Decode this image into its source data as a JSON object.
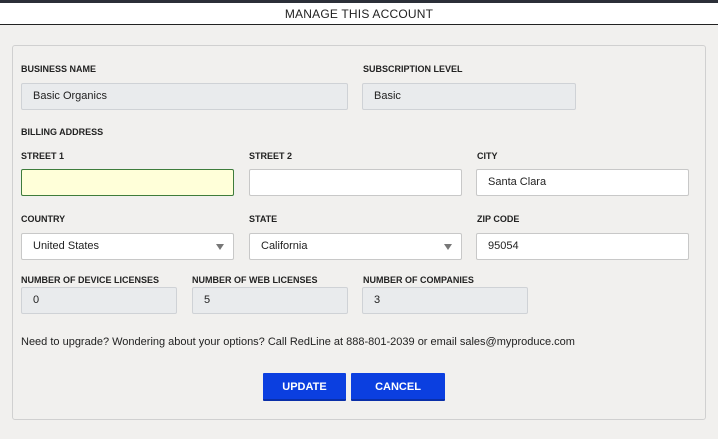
{
  "header": {
    "title": "MANAGE THIS ACCOUNT"
  },
  "form": {
    "business_name": {
      "label": "BUSINESS NAME",
      "value": "Basic Organics"
    },
    "subscription_level": {
      "label": "SUBSCRIPTION LEVEL",
      "value": "Basic"
    },
    "billing_address_label": "BILLING ADDRESS",
    "street1": {
      "label": "STREET 1",
      "value": ""
    },
    "street2": {
      "label": "STREET 2",
      "value": ""
    },
    "city": {
      "label": "CITY",
      "value": "Santa Clara"
    },
    "country": {
      "label": "COUNTRY",
      "value": "United States"
    },
    "state": {
      "label": "STATE",
      "value": "California"
    },
    "zip": {
      "label": "ZIP CODE",
      "value": "95054"
    },
    "device_licenses": {
      "label": "NUMBER OF DEVICE LICENSES",
      "value": "0"
    },
    "web_licenses": {
      "label": "NUMBER OF WEB LICENSES",
      "value": "5"
    },
    "companies": {
      "label": "NUMBER OF COMPANIES",
      "value": "3"
    },
    "info_text": "Need to upgrade? Wondering about your options? Call RedLine at 888-801-2039 or email sales@myproduce.com"
  },
  "buttons": {
    "update": "UPDATE",
    "cancel": "CANCEL"
  },
  "icons": {
    "select_arrow": "chevron-down-icon"
  },
  "colors": {
    "button": "#0b3fe0",
    "focus_field": "#ffffd9",
    "focus_border": "#3e7c3b",
    "readonly_field": "#e9ebed"
  }
}
